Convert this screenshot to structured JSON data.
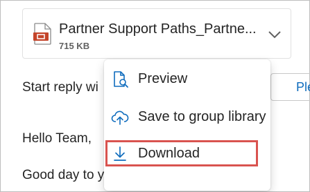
{
  "attachment": {
    "file_name": "Partner Support Paths_Partne...",
    "file_size": "715 KB",
    "file_icon": "pptx-file-icon",
    "expand_icon": "chevron-down-icon"
  },
  "compose": {
    "reply_prompt": "Start reply wi",
    "please_button_label": "Plea",
    "greeting": "Hello Team,",
    "good_day": "Good day to you."
  },
  "menu": {
    "items": [
      {
        "label": "Preview",
        "icon": "preview-icon"
      },
      {
        "label": "Save to group library",
        "icon": "cloud-upload-icon"
      },
      {
        "label": "Download",
        "icon": "download-icon"
      }
    ],
    "highlighted_item": "Download"
  },
  "colors": {
    "accent": "#0f6cbd",
    "file_icon": "#c4442a",
    "highlight_border": "#d9534f"
  }
}
